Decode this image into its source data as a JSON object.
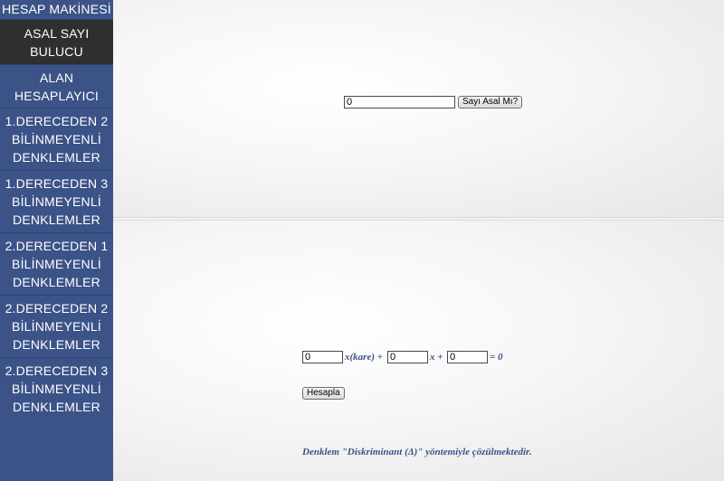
{
  "sidebar": {
    "items": [
      {
        "label": "HESAP MAKİNESİ"
      },
      {
        "label": "ASAL SAYI\nBULUCU"
      },
      {
        "label": "ALAN\nHESAPLAYICI"
      },
      {
        "label": "1.DERECEDEN 2\nBİLİNMEYENLİ\nDENKLEMLER"
      },
      {
        "label": "1.DERECEDEN 3\nBİLİNMEYENLİ\nDENKLEMLER"
      },
      {
        "label": "2.DERECEDEN 1\nBİLİNMEYENLİ\nDENKLEMLER"
      },
      {
        "label": "2.DERECEDEN 2\nBİLİNMEYENLİ\nDENKLEMLER"
      },
      {
        "label": "2.DERECEDEN 3\nBİLİNMEYENLİ\nDENKLEMLER"
      }
    ]
  },
  "prime": {
    "input_value": "0",
    "button_label": "Sayı Asal Mı?"
  },
  "quadratic": {
    "a_value": "0",
    "b_value": "0",
    "c_value": "0",
    "x_kare_text": "x(kare) +",
    "x_text": "x +",
    "equals_text": "= 0",
    "button_label": "Hesapla",
    "note": "Denklem \"Diskriminant (Δ)\" yöntemiyle çözülmektedir."
  },
  "colors": {
    "sidebar_bg": "#3c5387",
    "active_item_bg": "#2f2f2f",
    "accent_text": "#3c5387"
  }
}
